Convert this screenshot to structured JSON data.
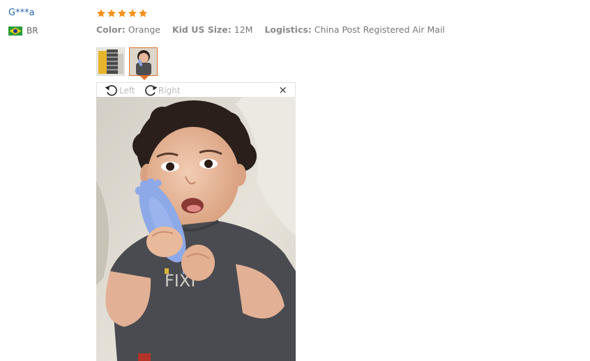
{
  "reviewer": {
    "name": "G***a",
    "country_code": "BR",
    "flag_icon": "brazil-flag-icon"
  },
  "review": {
    "rating": 5,
    "rating_max": 5,
    "star_color": "#f5931d",
    "attributes": [
      {
        "label": "Color:",
        "value": "Orange"
      },
      {
        "label": "Kid US Size:",
        "value": "12M"
      },
      {
        "label": "Logistics:",
        "value": "China Post Registered Air Mail"
      }
    ]
  },
  "thumbnails": [
    {
      "icon": "striped-clothes-photo-thumbnail",
      "active": false
    },
    {
      "icon": "baby-photo-thumbnail",
      "active": true
    }
  ],
  "viewer": {
    "rotate_left_label": "Left",
    "rotate_right_label": "Right",
    "close_symbol": "×",
    "photo": "baby-holding-blue-teether-photo"
  },
  "colors": {
    "accent": "#e4702b",
    "link": "#2a6ab0"
  }
}
